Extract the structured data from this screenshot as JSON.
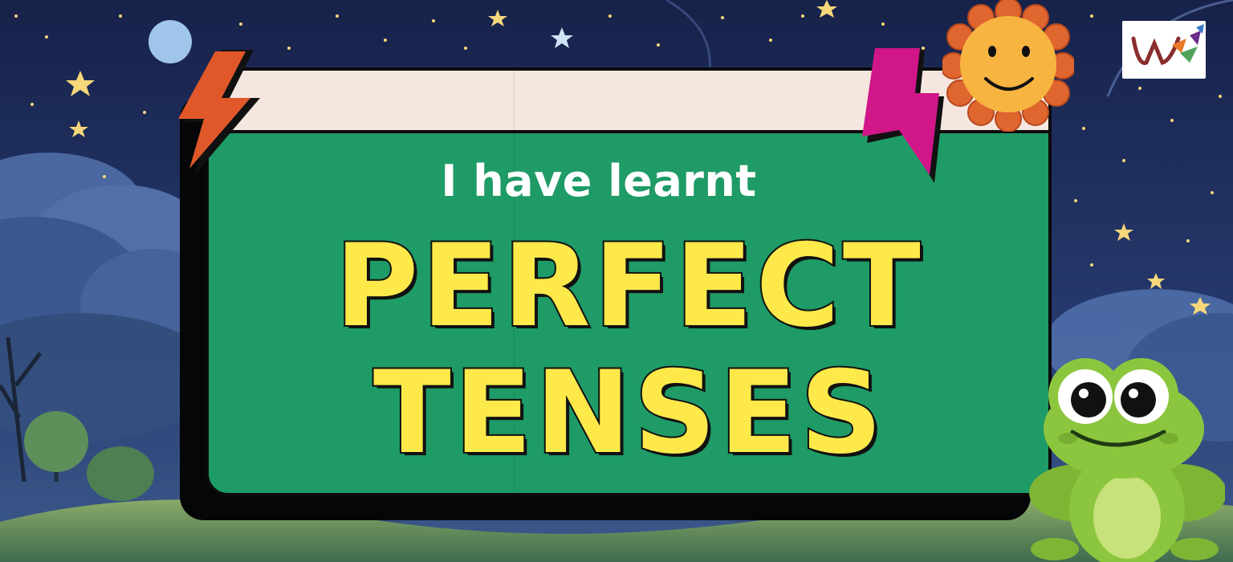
{
  "slide": {
    "subtitle": "I have learnt",
    "headline_line1": "PERFECT",
    "headline_line2": "TENSES"
  },
  "icons": {
    "logo": "w-logo-icon",
    "left_bolt": "lightning-bolt-icon",
    "right_bolt": "lightning-bolt-icon",
    "sun": "smiling-sun-icon",
    "frog": "smiling-frog-icon"
  },
  "colors": {
    "board_green": "#1e9b66",
    "board_top": "#f6e6e0",
    "headline_fill": "#fde94a",
    "left_bolt": "#e0582a",
    "right_bolt": "#d1168a",
    "sun_face": "#f7b441",
    "sun_petals": "#e0662f",
    "frog_green": "#8cc63e",
    "night_sky": "#1d2a55"
  }
}
